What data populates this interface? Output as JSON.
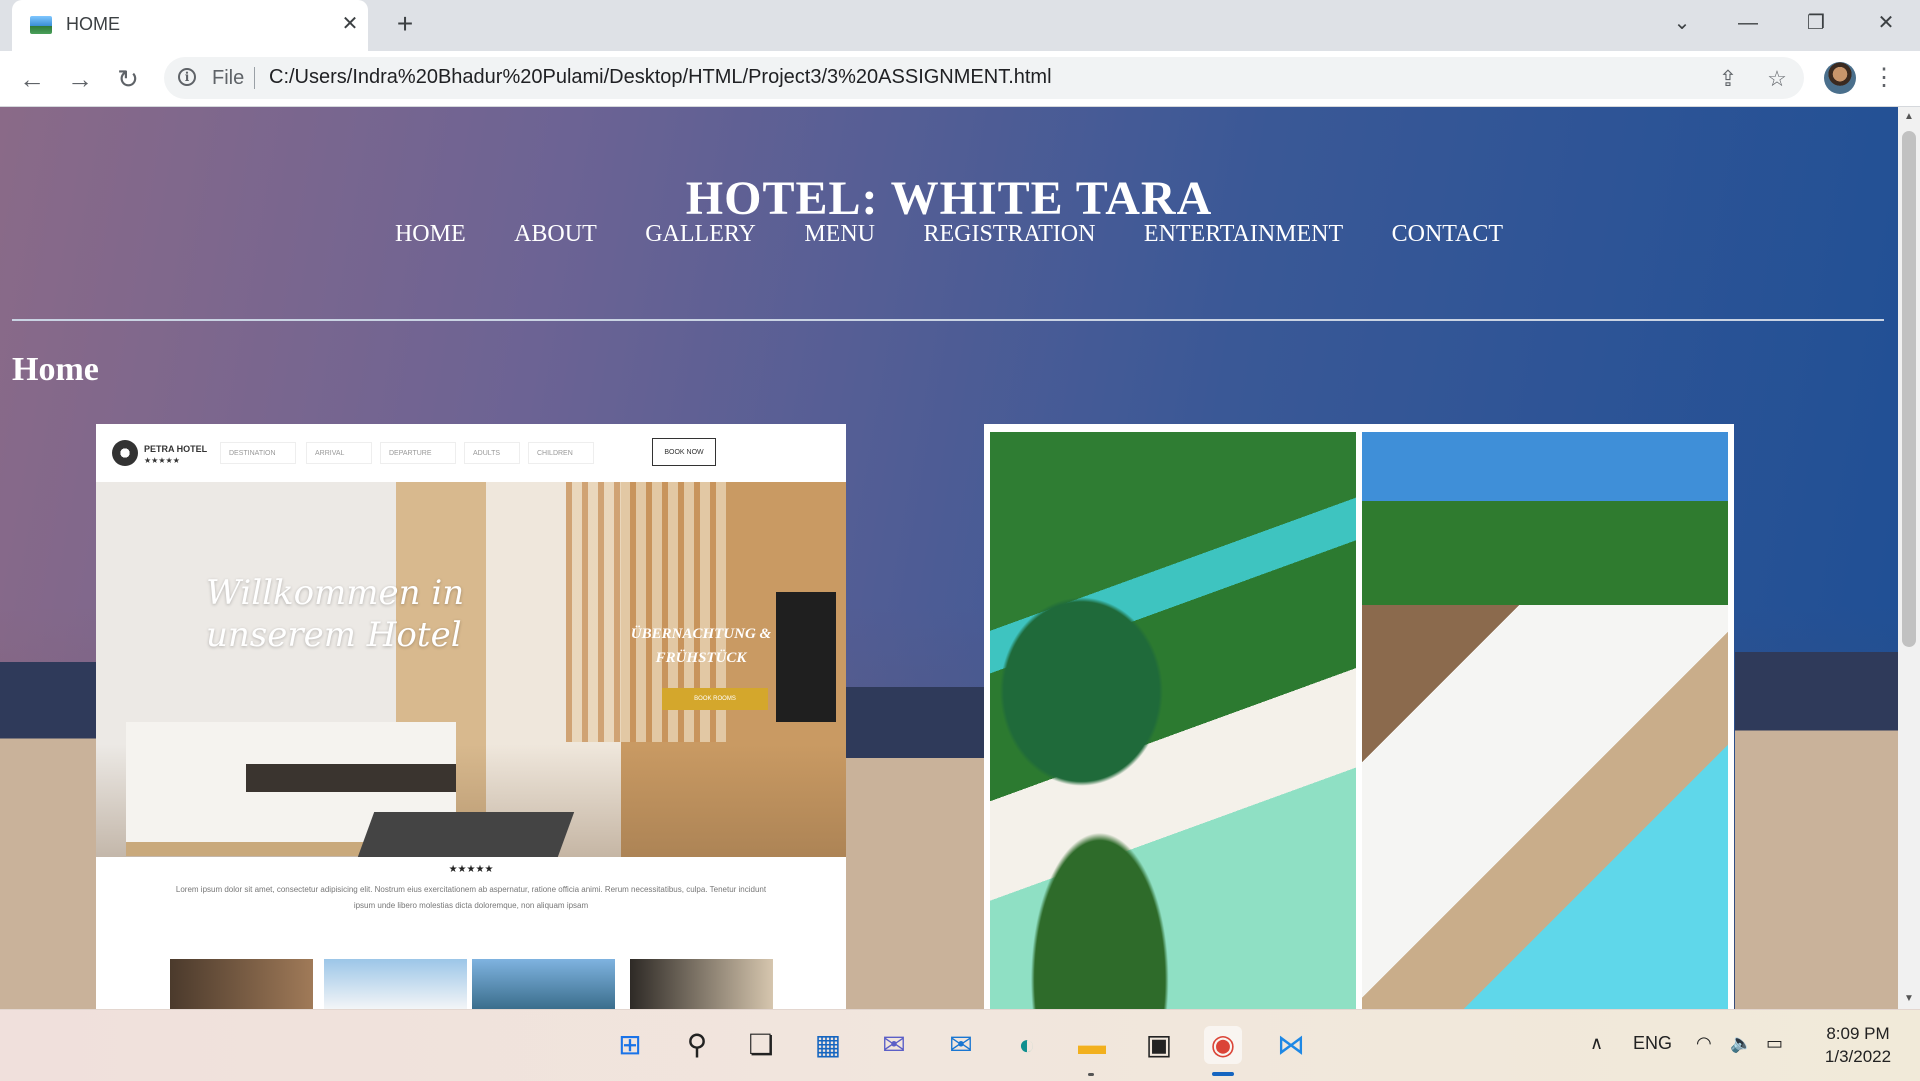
{
  "browser": {
    "tab_title": "HOME",
    "tab_close": "✕",
    "new_tab": "+",
    "scheme": "File",
    "url": "C:/Users/Indra%20Bhadur%20Pulami/Desktop/HTML/Project3/3%20ASSIGNMENT.html",
    "window_controls": [
      "⌄",
      "—",
      "❐",
      "✕"
    ]
  },
  "site": {
    "title": "HOTEL: WHITE TARA",
    "nav": [
      "HOME",
      "ABOUT",
      "GALLERY",
      "MENU",
      "REGISTRATION",
      "ENTERTAINMENT",
      "CONTACT"
    ],
    "section_heading": "Home"
  },
  "mockup": {
    "brand": "PETRA HOTEL",
    "brand_stars": "★★★★★",
    "fields": [
      "DESTINATION",
      "ARRIVAL",
      "DEPARTURE",
      "ADULTS",
      "CHILDREN"
    ],
    "book_button": "BOOK NOW",
    "headline_line1": "Willkommen in",
    "headline_line2": "unserem Hotel",
    "sub_line1": "ÜBERNACHTUNG &",
    "sub_line2": "FRÜHSTÜCK",
    "cta": "BOOK ROOMS",
    "rating_stars": "★★★★★",
    "body_text": "Lorem ipsum dolor sit amet, consectetur adipisicing elit. Nostrum eius exercitationem ab aspernatur, ratione officia animi. Rerum necessitatibus, culpa. Tenetur incidunt ipsum unde libero molestias dicta doloremque, non aliquam ipsam"
  },
  "taskbar": {
    "language": "ENG",
    "time": "8:09 PM",
    "date": "1/3/2022"
  },
  "colors": {
    "page_gradient_start": "#8a6a88",
    "page_gradient_end": "#1e4f95",
    "accent_gold": "#d4a72c",
    "chrome_tabbar": "#dee1e6"
  }
}
